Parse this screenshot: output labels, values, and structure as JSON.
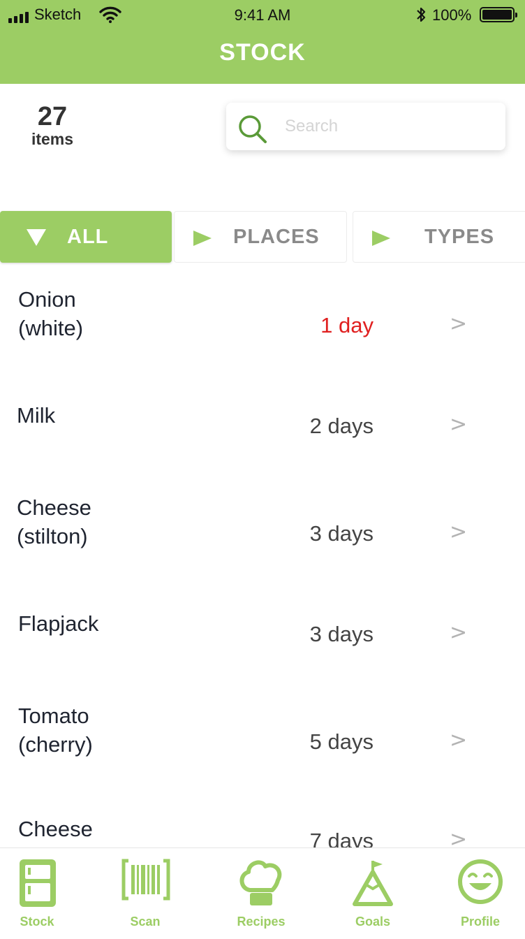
{
  "status_bar": {
    "carrier": "Sketch",
    "time": "9:41 AM",
    "battery": "100%"
  },
  "header": {
    "title": "STOCK"
  },
  "summary": {
    "count": "27",
    "count_label": "items"
  },
  "search": {
    "placeholder": "Search",
    "value": ""
  },
  "filters": {
    "all": "ALL",
    "places": "PLACES",
    "types": "TYPES",
    "selected": "ALL"
  },
  "items": [
    {
      "name": "Onion\n(white)",
      "days": "1 day",
      "urgent": true
    },
    {
      "name": "Milk",
      "days": "2 days",
      "urgent": false
    },
    {
      "name": "Cheese\n(stilton)",
      "days": "3 days",
      "urgent": false
    },
    {
      "name": "Flapjack",
      "days": "3 days",
      "urgent": false
    },
    {
      "name": "Tomato\n(cherry)",
      "days": "5 days",
      "urgent": false
    },
    {
      "name": "Cheese",
      "days": "7 days",
      "urgent": false
    }
  ],
  "chevron": ">",
  "tabbar": {
    "stock": "Stock",
    "scan": "Scan",
    "recipes": "Recipes",
    "goals": "Goals",
    "profile": "Profile"
  },
  "colors": {
    "accent": "#9ccd64",
    "urgent": "#e02020",
    "search_icon": "#5a9a38"
  },
  "icons": [
    "signal-bars-icon",
    "wifi-icon",
    "bluetooth-icon",
    "battery-icon",
    "search-icon",
    "triangle-down-icon",
    "triangle-right-icon",
    "fridge-icon",
    "barcode-icon",
    "chef-hat-icon",
    "mountain-flag-icon",
    "smiley-face-icon"
  ]
}
